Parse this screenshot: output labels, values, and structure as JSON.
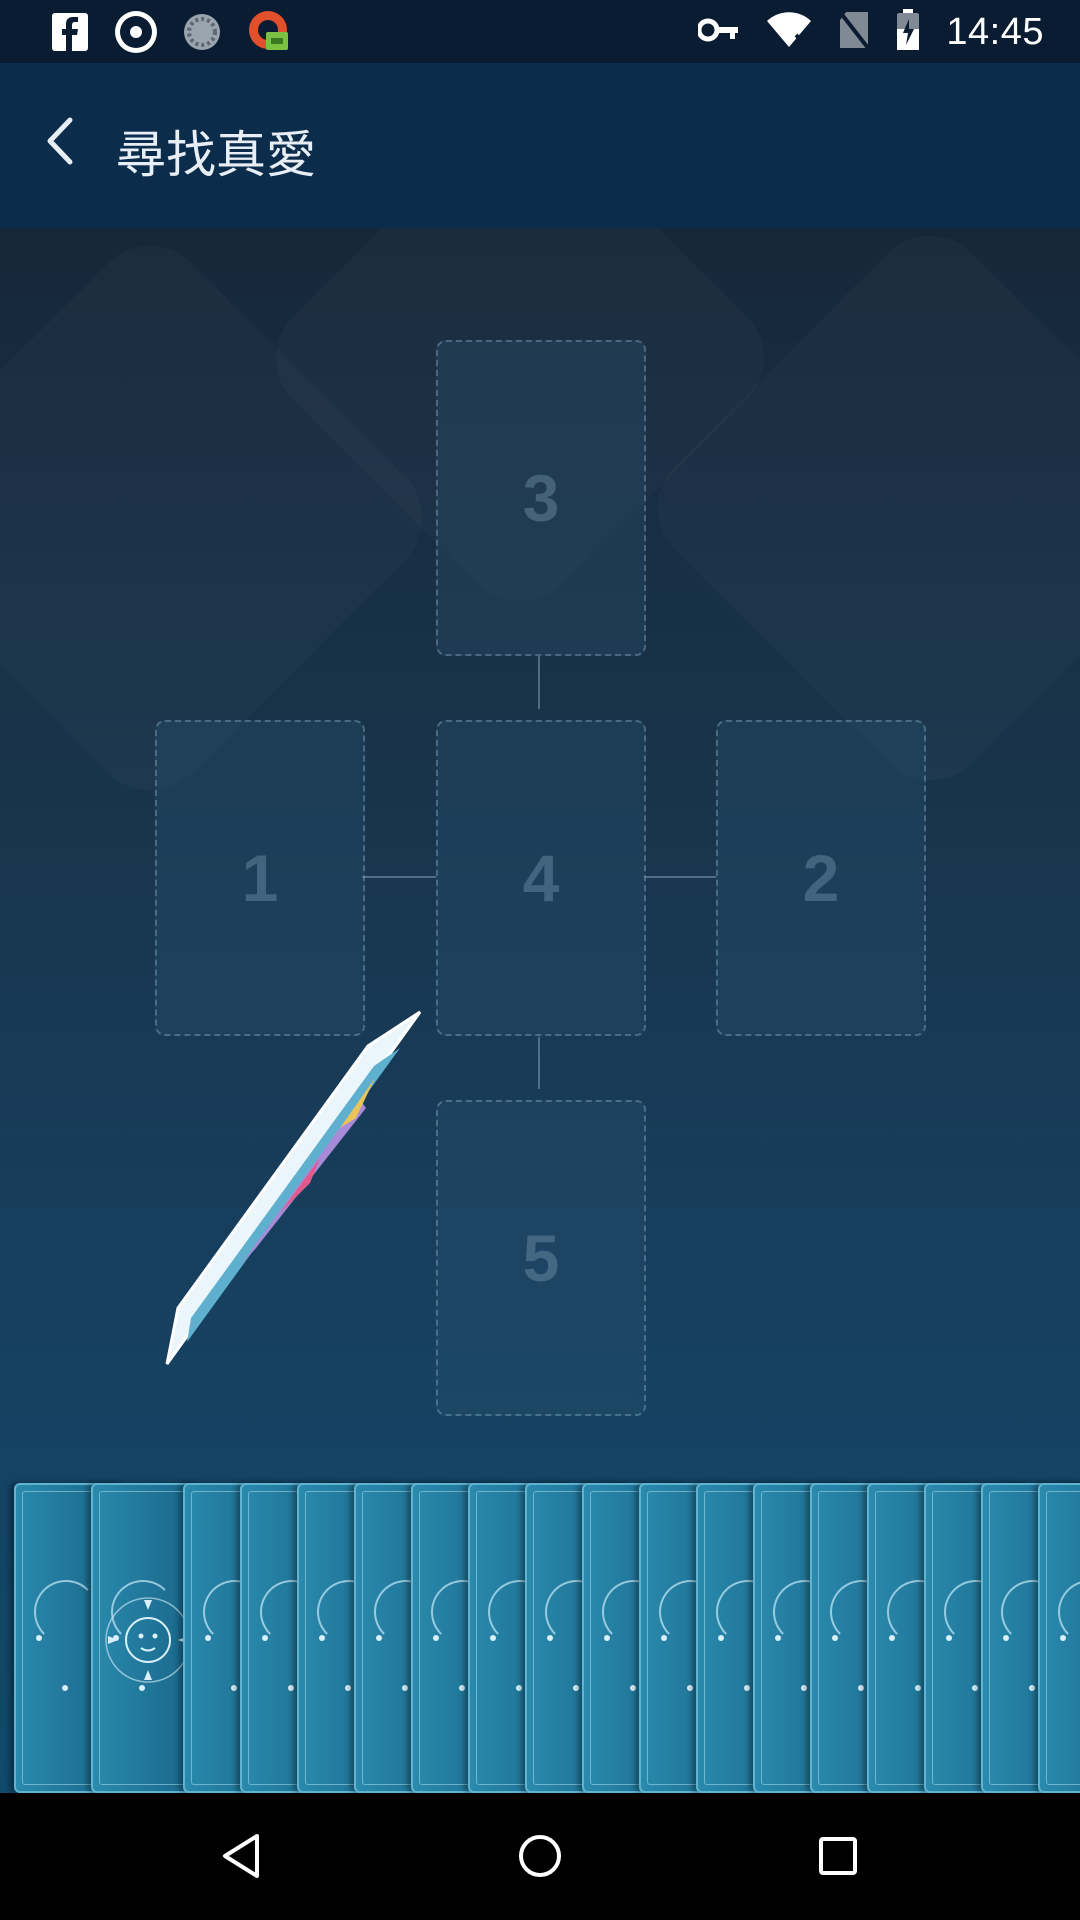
{
  "status_bar": {
    "time": "14:45",
    "left_icons": [
      "facebook-icon",
      "shutter-app-icon",
      "sync-spinner-icon",
      "vpn-app-icon"
    ],
    "right_icons": [
      "vpn-key-icon",
      "wifi-off-icon",
      "no-sim-icon",
      "battery-charging-icon"
    ]
  },
  "app_bar": {
    "title": "尋找真愛",
    "back_icon": "chevron-left-icon"
  },
  "spread": {
    "slots": [
      {
        "number": "3"
      },
      {
        "number": "1"
      },
      {
        "number": "4"
      },
      {
        "number": "2"
      },
      {
        "number": "5"
      }
    ]
  },
  "deck": {
    "visible_cards": 19
  },
  "nav_bar": {
    "buttons": [
      "back-triangle-icon",
      "home-circle-icon",
      "recents-square-icon"
    ]
  },
  "colors": {
    "status_bar_bg": "#0a1c31",
    "app_bar_bg": "#0c2c4c",
    "card_back": "#1f7396",
    "card_border": "#5fb4d2"
  }
}
